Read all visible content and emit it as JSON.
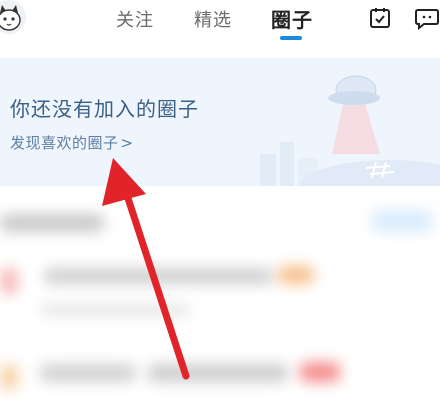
{
  "tabs": [
    {
      "label": "关注"
    },
    {
      "label": "精选"
    },
    {
      "label": "圈子"
    }
  ],
  "icons": {
    "avatar": "cat-avatar-icon",
    "calendar": "calendar-check-icon",
    "message": "message-bubble-icon"
  },
  "banner": {
    "title": "你还没有加入的圈子",
    "link": "发现喜欢的圈子",
    "link_chevron": ">"
  },
  "colors": {
    "accent": "#1a8be0",
    "annotation_arrow": "#e0242a"
  }
}
